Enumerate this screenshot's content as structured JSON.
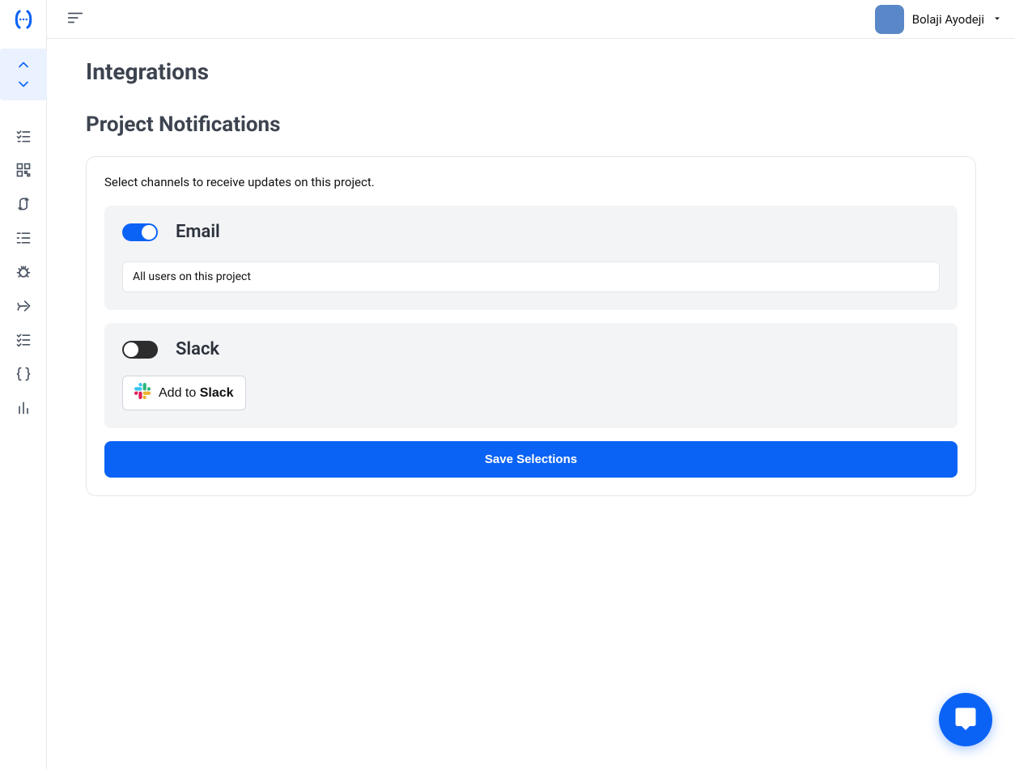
{
  "header": {
    "user_name": "Bolaji Ayodeji"
  },
  "page": {
    "title": "Integrations",
    "section_title": "Project Notifications",
    "card_subtitle": "Select channels to receive updates on this project."
  },
  "channels": {
    "email": {
      "label": "Email",
      "enabled": true,
      "recipients_label": "All users on this project"
    },
    "slack": {
      "label": "Slack",
      "enabled": false,
      "button_prefix": "Add to ",
      "button_bold": "Slack"
    }
  },
  "actions": {
    "save_label": "Save Selections"
  },
  "sidebar": {
    "icons": [
      "list-check-icon",
      "qr-icon",
      "flow-branch-icon",
      "list-indent-icon",
      "bug-icon",
      "share-icon",
      "checklist-icon",
      "braces-icon",
      "bar-chart-icon"
    ]
  }
}
